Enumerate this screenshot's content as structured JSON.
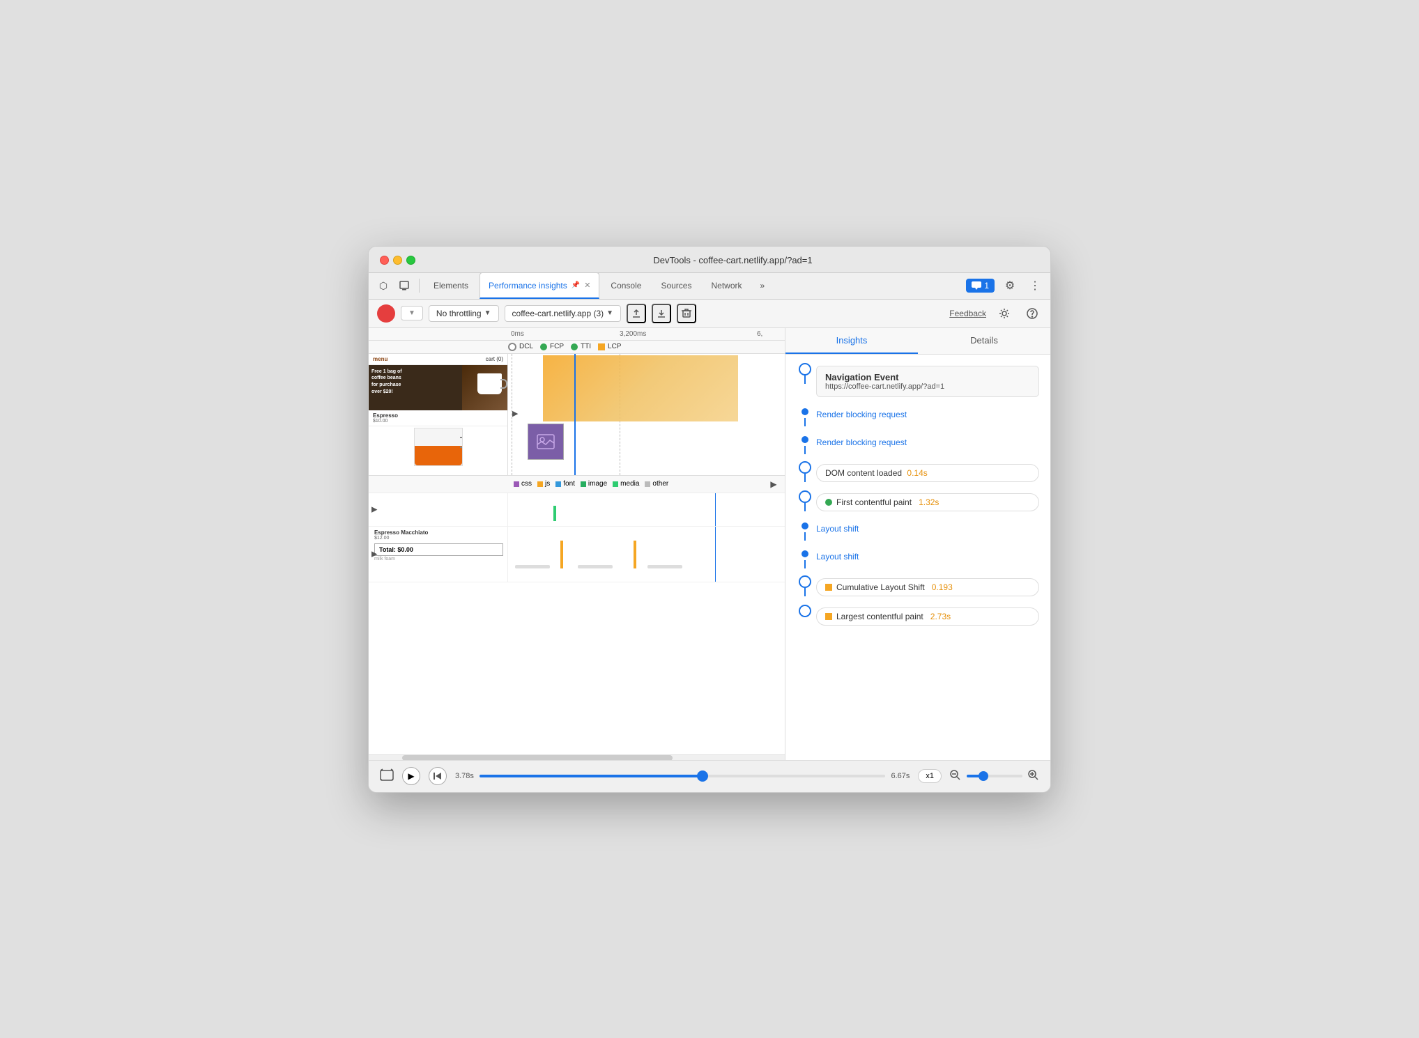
{
  "window": {
    "title": "DevTools - coffee-cart.netlify.app/?ad=1"
  },
  "tabs": {
    "items": [
      {
        "label": "Elements",
        "active": false
      },
      {
        "label": "Performance insights",
        "active": true,
        "pinned": true
      },
      {
        "label": "Console",
        "active": false
      },
      {
        "label": "Sources",
        "active": false
      },
      {
        "label": "Network",
        "active": false
      }
    ],
    "overflow_label": "»",
    "badge_label": "1",
    "settings_label": "⚙",
    "more_label": "⋮"
  },
  "toolbar": {
    "throttle_label": "No throttling",
    "site_label": "coffee-cart.netlify.app (3)",
    "feedback_label": "Feedback"
  },
  "timeline": {
    "timestamps": [
      "0ms",
      "3,200ms",
      "6,"
    ],
    "legend": [
      {
        "color": "#9b59b6",
        "label": "css"
      },
      {
        "color": "#f5a623",
        "label": "js"
      },
      {
        "color": "#3498db",
        "label": "font"
      },
      {
        "color": "#27ae60",
        "label": "image"
      },
      {
        "color": "#2ecc71",
        "label": "media"
      },
      {
        "color": "#bbb",
        "label": "other"
      }
    ],
    "dcl_label": "DCL",
    "fcp_label": "FCP",
    "tti_label": "TTI",
    "lcp_label": "LCP"
  },
  "website": {
    "menu_label": "menu",
    "cart_label": "cart (0)",
    "banner_text": "Free 1 bag of\ncoffee beans\nfor purchase\nover $20!",
    "product1_name": "Espresso",
    "product1_price": "$10.00",
    "product2_name": "Espresso Macchiato",
    "product2_price": "$12.00",
    "total_label": "Total: $0.00",
    "milk_foam_label": "milk foam"
  },
  "insights": {
    "tab_insights": "Insights",
    "tab_details": "Details",
    "nav_event_title": "Navigation Event",
    "nav_event_url": "https://coffee-cart.netlify.app/?ad=1",
    "render_blocking_1": "Render blocking request",
    "render_blocking_2": "Render blocking request",
    "dom_loaded_label": "DOM content loaded",
    "dom_loaded_value": "0.14s",
    "fcp_label": "First contentful paint",
    "fcp_value": "1.32s",
    "layout_shift_1": "Layout shift",
    "layout_shift_2": "Layout shift",
    "cls_label": "Cumulative Layout Shift",
    "cls_value": "0.193",
    "lcp_label": "Largest contentful paint",
    "lcp_value": "2.73s"
  },
  "bottom_bar": {
    "time_current": "3.78s",
    "time_end": "6.67s",
    "speed_label": "x1"
  },
  "colors": {
    "accent": "#1a73e8",
    "orange": "#f5a623",
    "green": "#34a853",
    "red": "#e53e3e",
    "purple": "#7b5ea7"
  }
}
